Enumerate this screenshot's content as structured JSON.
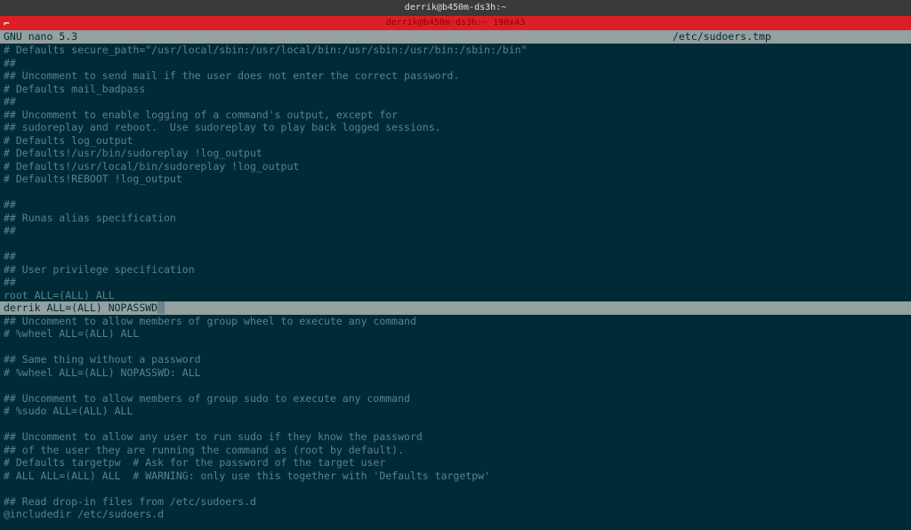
{
  "titlebar": {
    "title": "derrik@b450m-ds3h:~"
  },
  "redbar": {
    "icon": "⌐",
    "text": "derrik@b450m-ds3h:~ 190x43"
  },
  "nanobar": {
    "version": "  GNU nano 5.3",
    "filename": "/etc/sudoers.tmp"
  },
  "lines": {
    "l01": "# Defaults secure_path=\"/usr/local/sbin:/usr/local/bin:/usr/sbin:/usr/bin:/sbin:/bin\"",
    "l02": "##",
    "l03": "## Uncomment to send mail if the user does not enter the correct password.",
    "l04": "# Defaults mail_badpass",
    "l05": "##",
    "l06": "## Uncomment to enable logging of a command's output, except for",
    "l07": "## sudoreplay and reboot.  Use sudoreplay to play back logged sessions.",
    "l08": "# Defaults log_output",
    "l09": "# Defaults!/usr/bin/sudoreplay !log_output",
    "l10": "# Defaults!/usr/local/bin/sudoreplay !log_output",
    "l11": "# Defaults!REBOOT !log_output",
    "l12": "",
    "l13": "##",
    "l14": "## Runas alias specification",
    "l15": "##",
    "l16": "",
    "l17": "##",
    "l18": "## User privilege specification",
    "l19": "##",
    "l20": "root ALL=(ALL) ALL",
    "l21": "derrik ALL=(ALL) NOPASSWD",
    "l22": "## Uncomment to allow members of group wheel to execute any command",
    "l23": "# %wheel ALL=(ALL) ALL",
    "l24": "",
    "l25": "## Same thing without a password",
    "l26": "# %wheel ALL=(ALL) NOPASSWD: ALL",
    "l27": "",
    "l28": "## Uncomment to allow members of group sudo to execute any command",
    "l29": "# %sudo ALL=(ALL) ALL",
    "l30": "",
    "l31": "## Uncomment to allow any user to run sudo if they know the password",
    "l32": "## of the user they are running the command as (root by default).",
    "l33": "# Defaults targetpw  # Ask for the password of the target user",
    "l34": "# ALL ALL=(ALL) ALL  # WARNING: only use this together with 'Defaults targetpw'",
    "l35": "",
    "l36": "## Read drop-in files from /etc/sudoers.d",
    "l37": "@includedir /etc/sudoers.d"
  }
}
